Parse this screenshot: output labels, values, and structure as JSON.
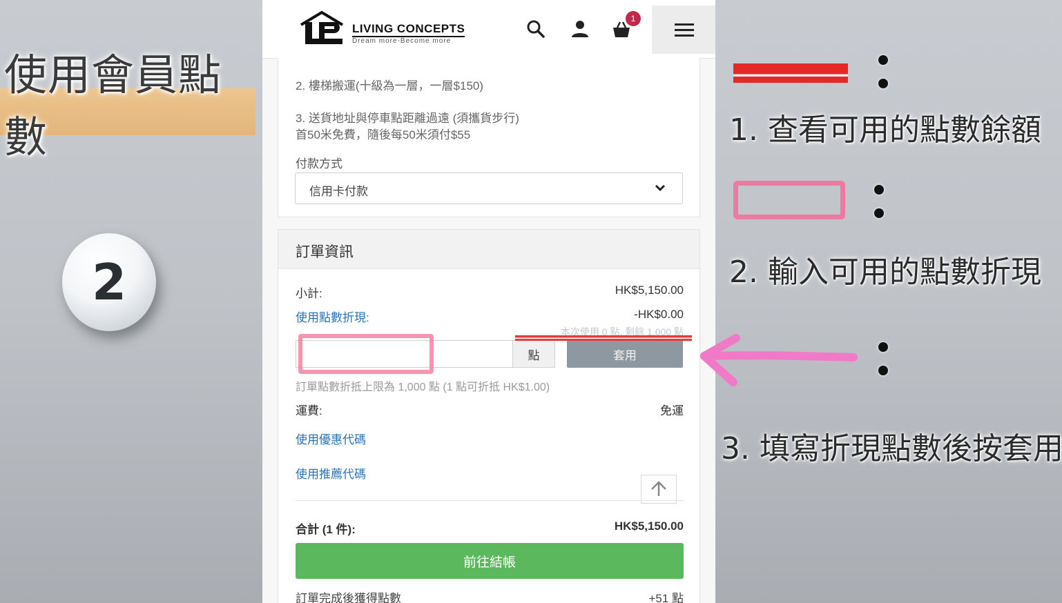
{
  "overlay": {
    "title": "使用會員點數",
    "step_number": "2",
    "legend": [
      {
        "text": "1. 查看可用的點數餘額"
      },
      {
        "text": "2. 輸入可用的點數折現"
      },
      {
        "text": "3. 填寫折現點數後按套用"
      }
    ],
    "colors": {
      "red_mark": "#e42828",
      "pink_mark": "#f46896",
      "title_band": "#e6b474"
    }
  },
  "header": {
    "logo_text": "LIVING CONCEPTS",
    "logo_tagline": "Dream more-Become more",
    "cart_count": "1",
    "icons": [
      "search-icon",
      "user-icon",
      "cart-icon",
      "hamburger-menu-icon"
    ]
  },
  "delivery_notes": {
    "stairs": "2. 樓梯搬運(十級為一層，一層$150)",
    "distance_line1": "3. 送貨地址與停車點距離過遠 (須攜貨步行)",
    "distance_line2": "首50米免費，隨後每50米須付$55"
  },
  "payment": {
    "label": "付款方式",
    "selected": "信用卡付款"
  },
  "order": {
    "heading": "訂單資訊",
    "subtotal_label": "小計:",
    "subtotal_value": "HK$5,150.00",
    "points_label": "使用點數折現:",
    "points_value": "-HK$0.00",
    "points_hint": "本次使用 0 點, 剩餘 1,000 點",
    "points_input_value": "",
    "points_unit": "點",
    "apply_label": "套用",
    "points_limit": "訂單點數折抵上限為 1,000 點 (1 點可折抵 HK$1.00)",
    "shipping_label": "運費:",
    "shipping_value": "免運",
    "coupon_link": "使用優惠代碼",
    "referral_link": "使用推薦代碼",
    "total_label": "合計 (1 件):",
    "total_value": "HK$5,150.00",
    "checkout_label": "前往結帳",
    "earn_label": "訂單完成後獲得點數",
    "earn_value": "+51 點",
    "accent_link": "#2b73b6",
    "checkout_color": "#5cb85c"
  }
}
